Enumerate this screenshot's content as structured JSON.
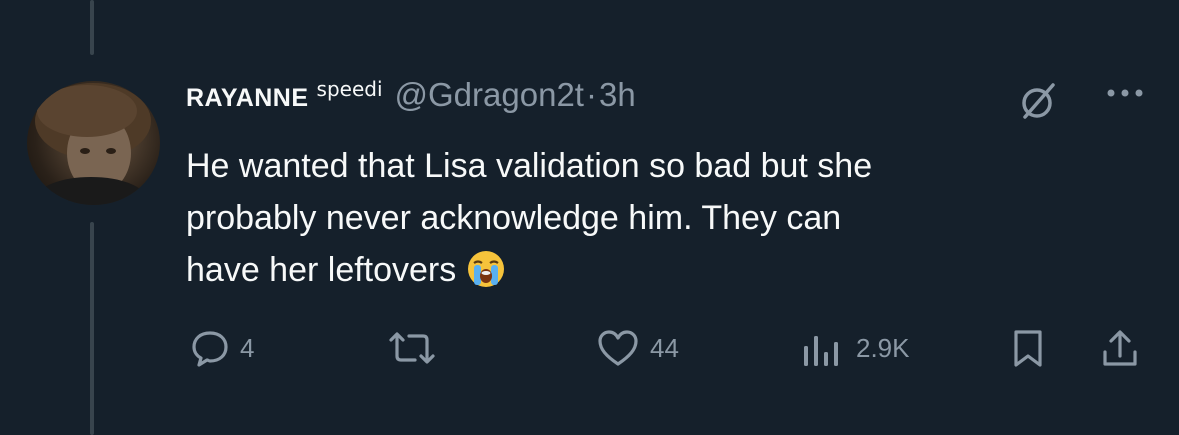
{
  "tweet": {
    "display_name": "RAYANNE",
    "name_tag": "speedi",
    "handle": "@Gdragon2t",
    "separator": "·",
    "time": "3h",
    "text_line1": "He wanted that Lisa validation so bad but she",
    "text_line2": "probably never acknowledge him. They can",
    "text_line3": "have her leftovers",
    "emoji": "loudly-crying-face"
  },
  "actions": {
    "reply_count": "4",
    "retweet_count": "",
    "like_count": "44",
    "view_count": "2.9K"
  },
  "colors": {
    "background": "#15202b",
    "text": "#f7f9f9",
    "muted": "#8b98a5",
    "thread_line": "#38444d"
  }
}
